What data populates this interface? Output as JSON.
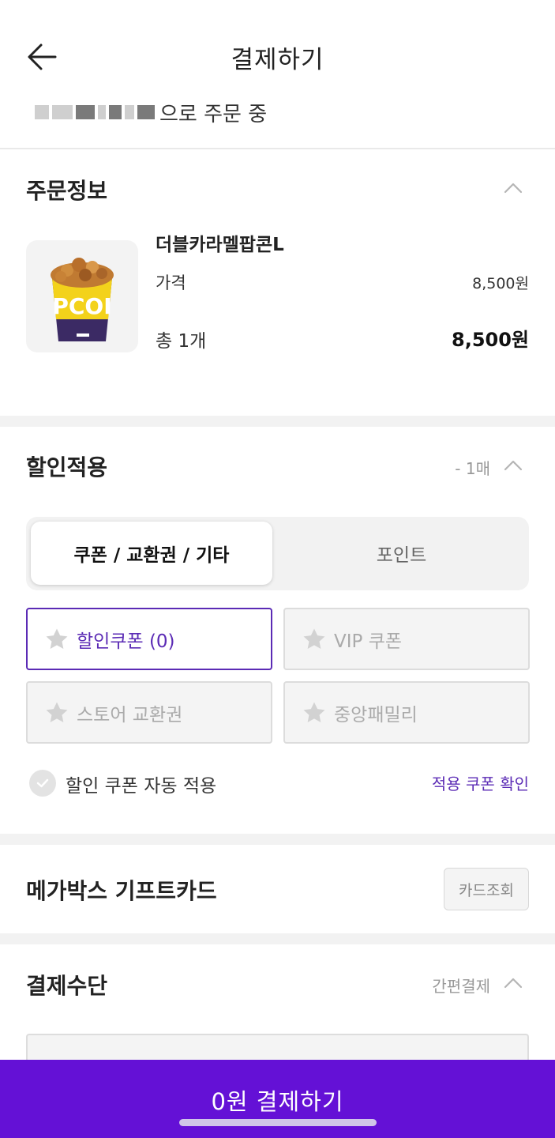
{
  "header": {
    "title": "결제하기",
    "ordering_suffix": "으로 주문 중"
  },
  "order_info": {
    "title": "주문정보",
    "product_name": "더블카라멜팝콘L",
    "price_label": "가격",
    "price_value": "8,500원",
    "total_label": "총 1개",
    "total_value": "8,500원"
  },
  "discount": {
    "title": "할인적용",
    "count": "- 1매",
    "tabs": [
      {
        "label": "쿠폰 / 교환권 / 기타",
        "active": true
      },
      {
        "label": "포인트",
        "active": false
      }
    ],
    "options": [
      {
        "label": "할인쿠폰 (0)",
        "selected": true
      },
      {
        "label": "VIP 쿠폰",
        "selected": false
      },
      {
        "label": "스토어 교환권",
        "selected": false
      },
      {
        "label": "중앙패밀리",
        "selected": false
      }
    ],
    "auto_apply_label": "할인 쿠폰 자동 적용",
    "coupon_check_link": "적용 쿠폰 확인"
  },
  "gift_card": {
    "title": "메가박스 기프트카드",
    "button_label": "카드조회"
  },
  "payment_method": {
    "title": "결제수단",
    "easy_pay_label": "간편결제"
  },
  "bottom_bar": {
    "label": "0원 결제하기"
  },
  "colors": {
    "accent": "#5b2bb5",
    "bottom_bar": "#6411d6"
  }
}
